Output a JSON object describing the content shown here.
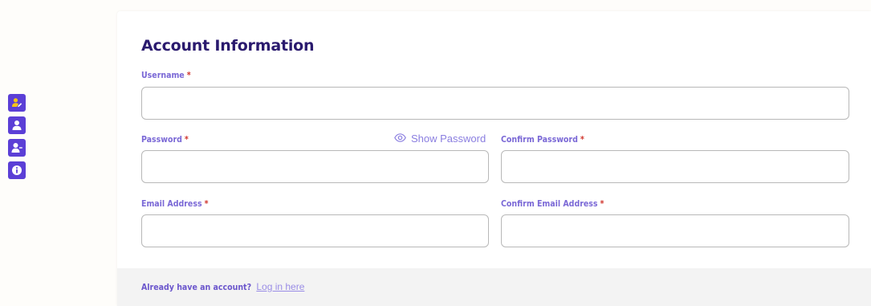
{
  "sidebar": {
    "items": [
      {
        "icon": "user-edit-icon"
      },
      {
        "icon": "user-icon"
      },
      {
        "icon": "user-minus-icon"
      },
      {
        "icon": "info-icon"
      }
    ],
    "accent_color": "#5b3fd6"
  },
  "form": {
    "title": "Account Information",
    "required_mark": "*",
    "username": {
      "label": "Username",
      "value": ""
    },
    "password": {
      "label": "Password",
      "value": ""
    },
    "show_password_label": "Show Password",
    "confirm_password": {
      "label": "Confirm Password",
      "value": ""
    },
    "email": {
      "label": "Email Address",
      "value": ""
    },
    "confirm_email": {
      "label": "Confirm Email Address",
      "value": ""
    }
  },
  "footer": {
    "prompt": "Already have an account?",
    "link_label": "Log in here"
  },
  "colors": {
    "title": "#2a1a6e",
    "label": "#7a68d6",
    "required": "#d0342c",
    "link": "#9a8de6"
  }
}
